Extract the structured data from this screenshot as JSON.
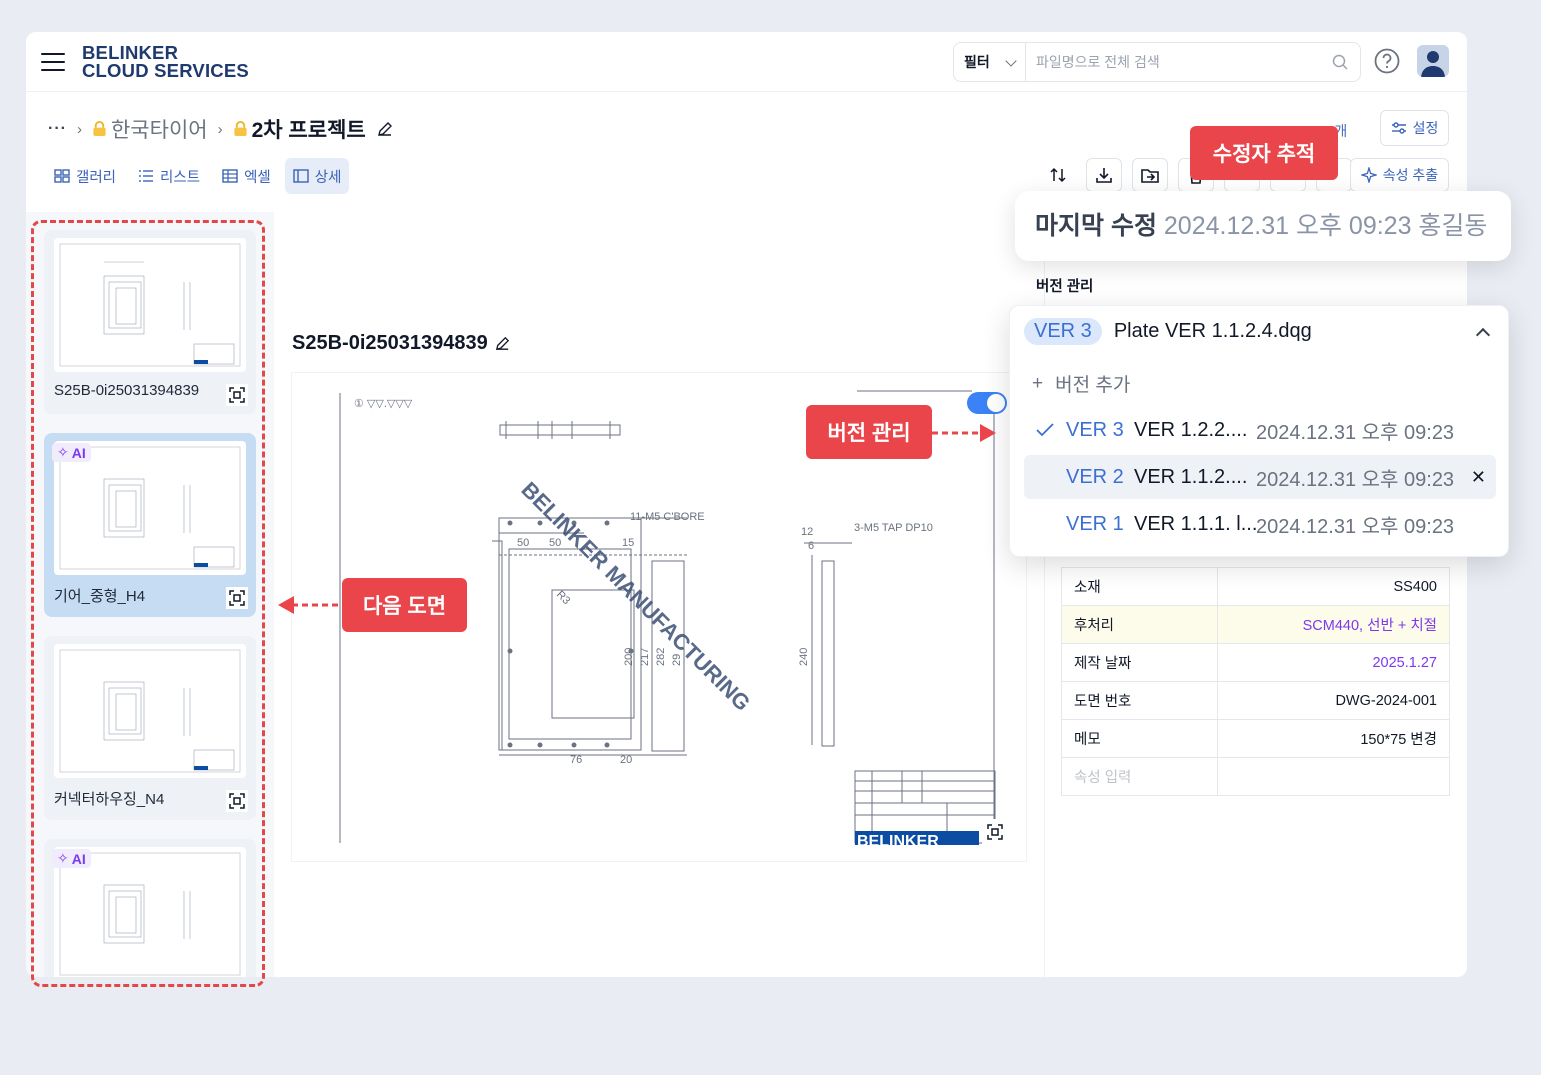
{
  "header": {
    "logo_line1": "BELINKER",
    "logo_line2": "CLOUD SERVICES",
    "filter_label": "필터",
    "search_placeholder": "파일명으로 전체 검색"
  },
  "breadcrumb": {
    "more": "···",
    "items": [
      "한국타이어",
      "2차 프로젝트"
    ]
  },
  "view_tabs": [
    "갤러리",
    "리스트",
    "엑셀",
    "상세"
  ],
  "active_tab": "상세",
  "toolbar": {
    "count": "100개",
    "settings_label": "설정",
    "extract_label": "속성 추출"
  },
  "files": [
    {
      "name": "S25B-0i25031394839",
      "ai": false,
      "selected": false
    },
    {
      "name": "기어_중형_H4",
      "ai": true,
      "selected": true
    },
    {
      "name": "커넥터하우징_N4",
      "ai": false,
      "selected": false
    },
    {
      "name": "",
      "ai": true,
      "selected": false
    }
  ],
  "ai_badge": "AI",
  "document": {
    "title": "S25B-0i25031394839",
    "watermark": "BELINKER MANUFACTURING",
    "drawing_labels": {
      "top_left": "① ▽▽.▽▽▽",
      "cbore": "11-M5 C'BORE",
      "tap": "3-M5 TAP DP10",
      "dims_top": [
        "50",
        "50",
        "15"
      ],
      "dims_left": [
        "200",
        "217",
        "282",
        "29"
      ],
      "dims_bottom": [
        "76",
        "20"
      ],
      "dims_side": [
        "12",
        "6",
        "240"
      ],
      "r_label": "R3",
      "title_block": "BELINKER"
    }
  },
  "last_modified": {
    "label": "마지막 수정",
    "value": "2024.12.31 오후 09:23 홍길동"
  },
  "version_section_label": "버전 관리",
  "version_dropdown": {
    "current_badge": "VER 3",
    "current_file": "Plate VER 1.1.2.4.dqg",
    "add_label": "버전 추가",
    "rows": [
      {
        "ver": "VER 3",
        "file": "VER 1.2.2....",
        "date": "2024.12.31 오후 09:23",
        "checked": true
      },
      {
        "ver": "VER 2",
        "file": "VER 1.1.2....",
        "date": "2024.12.31 오후 09:23",
        "hover": true
      },
      {
        "ver": "VER 1",
        "file": "VER 1.1.1. l...",
        "date": "2024.12.31 오후 09:23"
      }
    ]
  },
  "properties": [
    {
      "key": "소재",
      "value": "SS400"
    },
    {
      "key": "후처리",
      "value": "SCM440, 선반 + 치절",
      "highlight": true,
      "accent": true
    },
    {
      "key": "제작 날짜",
      "value": "2025.1.27",
      "accent": true
    },
    {
      "key": "도면 번호",
      "value": "DWG-2024-001"
    },
    {
      "key": "메모",
      "value": "150*75 변경"
    },
    {
      "key": "속성 입력",
      "value": "",
      "placeholder": true
    }
  ],
  "callouts": {
    "editor_tracking": "수정자 추적",
    "version_management": "버전 관리",
    "next_drawing": "다음 도면"
  },
  "colors": {
    "brand": "#1e3a6e",
    "accent_blue": "#3b6fd1",
    "callout_red": "#e9454a",
    "ai_purple": "#7c3aed",
    "selected_card": "#c6dcf3"
  }
}
